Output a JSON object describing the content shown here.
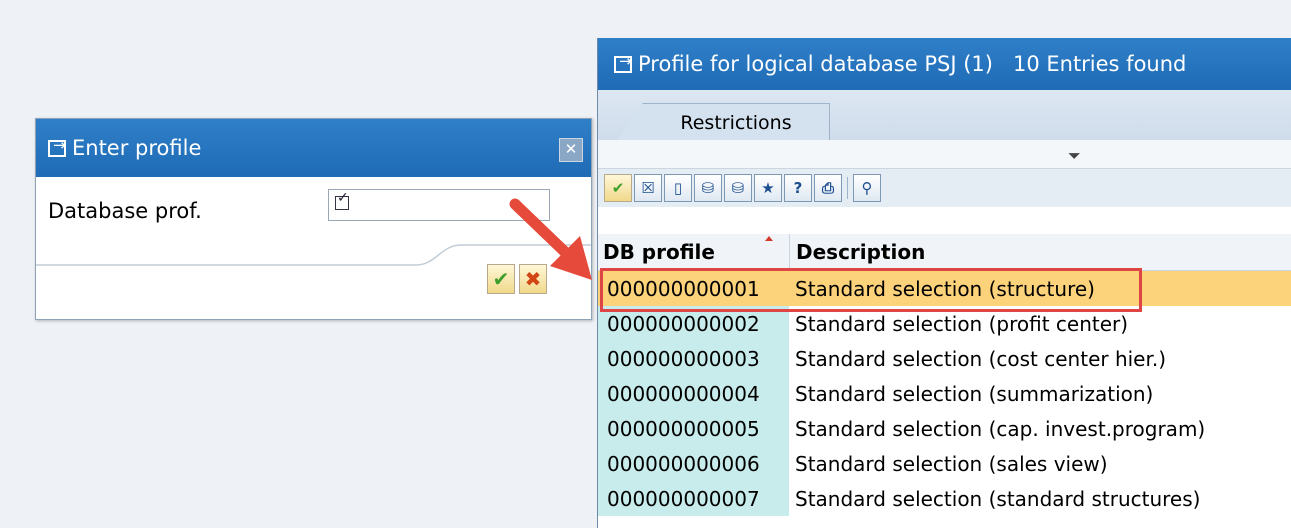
{
  "enter_profile": {
    "title": "Enter profile",
    "field_label": "Database prof.",
    "field_value": ""
  },
  "profile_popup": {
    "title": "Profile for logical database PSJ (1)   10 Entries found",
    "tab_label": "Restrictions",
    "columns": [
      "DB profile",
      "Description"
    ],
    "rows": [
      {
        "id": "000000000001",
        "desc": "Standard selection (structure)"
      },
      {
        "id": "000000000002",
        "desc": "Standard selection (profit center)"
      },
      {
        "id": "000000000003",
        "desc": "Standard selection (cost center hier.)"
      },
      {
        "id": "000000000004",
        "desc": "Standard selection (summarization)"
      },
      {
        "id": "000000000005",
        "desc": "Standard selection (cap. invest.program)"
      },
      {
        "id": "000000000006",
        "desc": "Standard selection (sales view)"
      },
      {
        "id": "000000000007",
        "desc": "Standard selection (standard structures)"
      }
    ]
  },
  "colors": {
    "title_bar": "#1f6bb5",
    "highlight_row": "#fcd27a",
    "annotation": "#e04545"
  }
}
